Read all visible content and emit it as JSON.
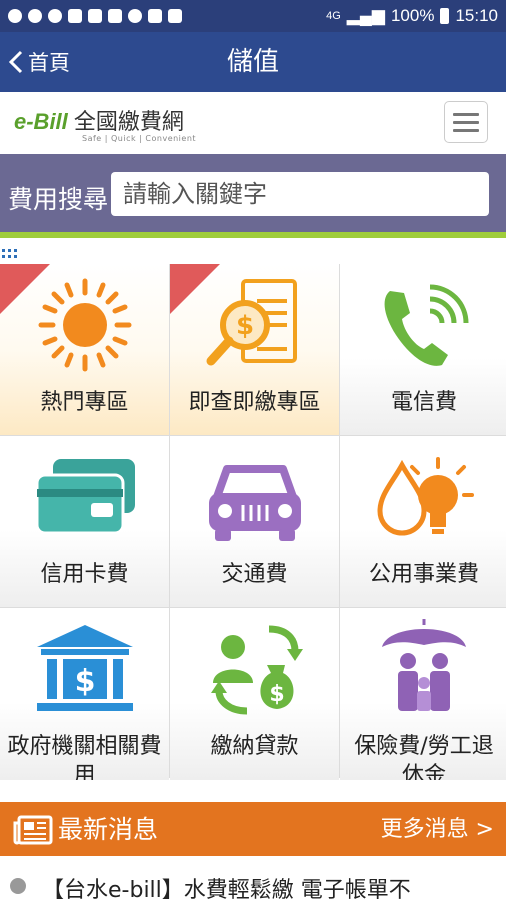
{
  "status_bar": {
    "battery": "100%",
    "time": "15:10",
    "network": "4G"
  },
  "nav": {
    "back_label": "首頁",
    "title": "儲值"
  },
  "brand": {
    "logo_e": "e-Bill",
    "logo_text": "全國繳費網",
    "tagline": "Safe | Quick | Convenient"
  },
  "search": {
    "label": "費用搜尋",
    "placeholder": "請輸入關鍵字"
  },
  "tiles": [
    {
      "label": "熱門專區",
      "icon": "sun-icon"
    },
    {
      "label": "即查即繳專區",
      "icon": "magnifier-bill-icon"
    },
    {
      "label": "電信費",
      "icon": "phone-icon"
    },
    {
      "label": "信用卡費",
      "icon": "credit-card-icon"
    },
    {
      "label": "交通費",
      "icon": "car-icon"
    },
    {
      "label": "公用事業費",
      "icon": "water-lightbulb-icon"
    },
    {
      "label": "政府機關相關費用",
      "icon": "government-building-icon"
    },
    {
      "label": "繳納貸款",
      "icon": "loan-icon"
    },
    {
      "label": "保險費/勞工退休金",
      "icon": "family-umbrella-icon"
    }
  ],
  "news": {
    "title": "最新消息",
    "more": "更多消息 >",
    "first_item": "【台水e-bill】水費輕鬆繳 電子帳單不"
  },
  "colors": {
    "nav_blue": "#2d4a8f",
    "search_purple": "#6b6993",
    "accent_green": "#9fcd3b",
    "news_orange": "#e3741f",
    "hot_ribbon": "#e05a5a"
  }
}
